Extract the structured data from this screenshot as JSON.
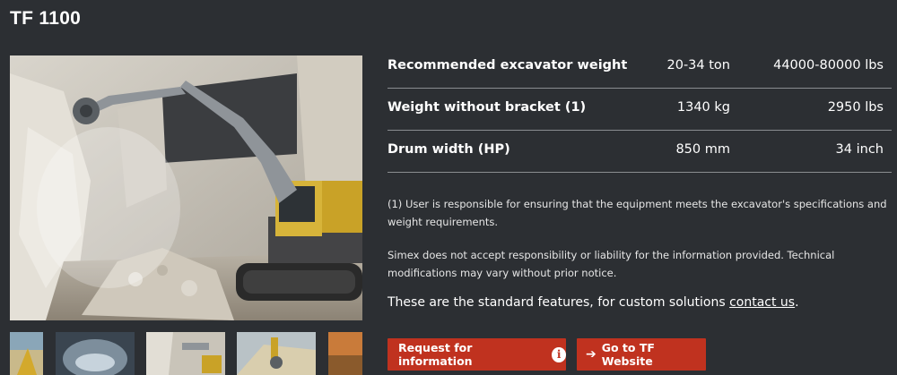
{
  "page": {
    "title": "TF 1100"
  },
  "specs": [
    {
      "label": "Recommended excavator weight",
      "metric": "20-34 ton",
      "imperial": "44000-80000 lbs"
    },
    {
      "label": "Weight without bracket (1)",
      "metric": "1340 kg",
      "imperial": "2950 lbs"
    },
    {
      "label": "Drum width (HP)",
      "metric": "850 mm",
      "imperial": "34 inch"
    }
  ],
  "notes": {
    "responsibility": "(1) User is responsible for ensuring that the equipment meets the excavator's specifications and weight requirements.",
    "liability": "Simex does not accept responsibility or liability for the information provided. Technical modifications may vary without prior notice."
  },
  "standard": {
    "text": "These are the standard features, for custom solutions ",
    "link": "contact us",
    "suffix": "."
  },
  "buttons": {
    "request": "Request for information",
    "website": "Go to TF Website"
  },
  "colors": {
    "background": "#2c2f33",
    "accent": "#c0321f",
    "divider": "#8a8d90"
  },
  "icons": {
    "info": "info-circle-icon",
    "arrow": "arrow-right-icon"
  }
}
